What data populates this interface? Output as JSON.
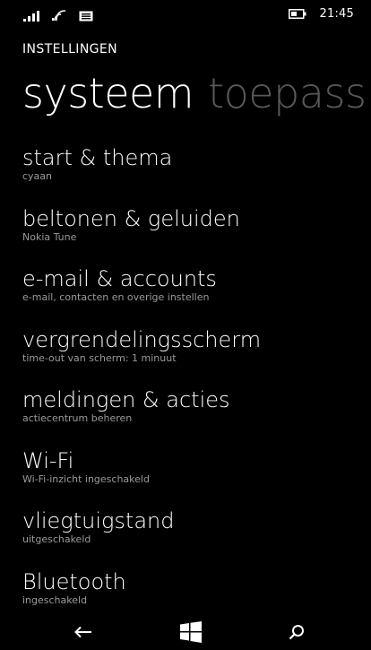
{
  "status_bar": {
    "time": "21:45",
    "icons": [
      "signal-icon",
      "wifi-icon",
      "message-icon",
      "battery-icon"
    ]
  },
  "app_title": "INSTELLINGEN",
  "pivot": {
    "active": "systeem",
    "next": "toepass"
  },
  "items": [
    {
      "title": "start & thema",
      "subtitle": "cyaan"
    },
    {
      "title": "beltonen & geluiden",
      "subtitle": "Nokia Tune"
    },
    {
      "title": "e-mail & accounts",
      "subtitle": "e-mail, contacten en overige instellen"
    },
    {
      "title": "vergrendelingsscherm",
      "subtitle": "time-out van scherm: 1 minuut"
    },
    {
      "title": "meldingen & acties",
      "subtitle": "actiecentrum beheren"
    },
    {
      "title": "Wi-Fi",
      "subtitle": "Wi-Fi-inzicht ingeschakeld"
    },
    {
      "title": "vliegtuigstand",
      "subtitle": "uitgeschakeld"
    },
    {
      "title": "Bluetooth",
      "subtitle": "ingeschakeld"
    }
  ],
  "nav": {
    "icons": [
      "back-arrow-icon",
      "windows-start-icon",
      "search-icon"
    ]
  },
  "colors": {
    "background": "#000000",
    "text": "#ffffff",
    "secondary_text": "#9a9a9a",
    "inactive_pivot": "#595959"
  }
}
